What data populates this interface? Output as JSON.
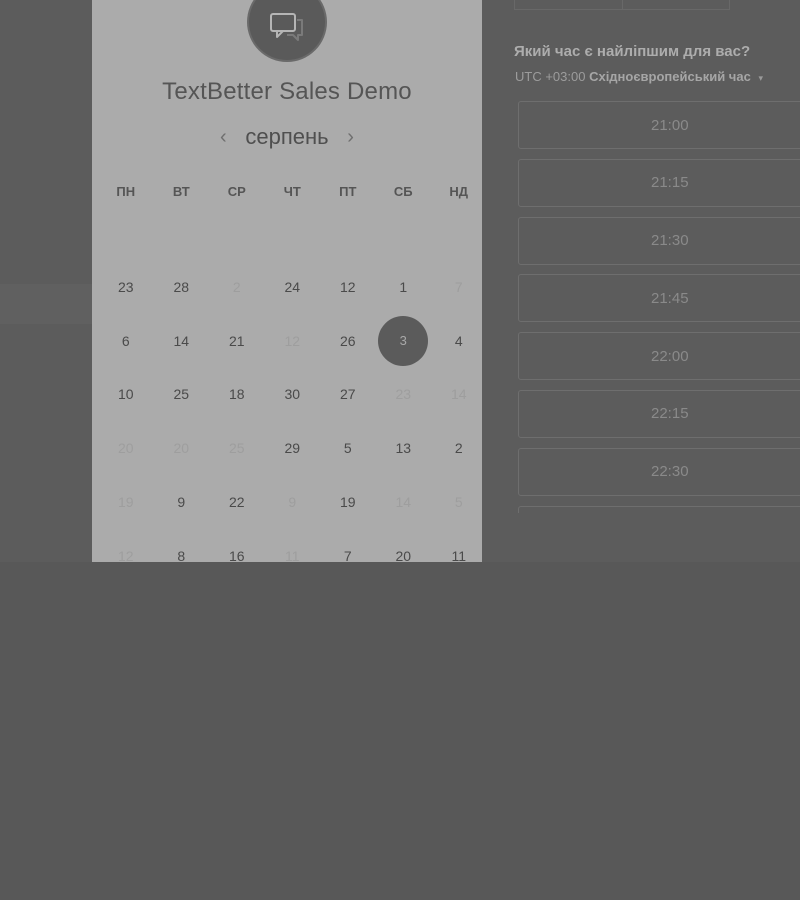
{
  "event": {
    "title": "TextBetter Sales Demo",
    "icon": "chat-bubble-icon"
  },
  "calendar": {
    "month": "серпень",
    "prev_icon": "‹",
    "next_icon": "›",
    "weekdays": [
      "ПН",
      "ВТ",
      "СР",
      "ЧТ",
      "ПТ",
      "СБ",
      "НД"
    ],
    "days": [
      {
        "label": "23",
        "muted": false
      },
      {
        "label": "28",
        "muted": false
      },
      {
        "label": "2",
        "muted": true
      },
      {
        "label": "24",
        "muted": false
      },
      {
        "label": "12",
        "muted": false
      },
      {
        "label": "1",
        "muted": false
      },
      {
        "label": "7",
        "muted": true
      },
      {
        "label": "6",
        "muted": false
      },
      {
        "label": "14",
        "muted": false
      },
      {
        "label": "21",
        "muted": false
      },
      {
        "label": "12",
        "muted": true
      },
      {
        "label": "26",
        "muted": false
      },
      {
        "label": "3",
        "muted": false,
        "selected": true
      },
      {
        "label": "4",
        "muted": false
      },
      {
        "label": "10",
        "muted": false
      },
      {
        "label": "25",
        "muted": false
      },
      {
        "label": "18",
        "muted": false
      },
      {
        "label": "30",
        "muted": false
      },
      {
        "label": "27",
        "muted": false
      },
      {
        "label": "23",
        "muted": true
      },
      {
        "label": "14",
        "muted": true
      },
      {
        "label": "20",
        "muted": true
      },
      {
        "label": "20",
        "muted": true
      },
      {
        "label": "25",
        "muted": true
      },
      {
        "label": "29",
        "muted": false
      },
      {
        "label": "5",
        "muted": false
      },
      {
        "label": "13",
        "muted": false
      },
      {
        "label": "2",
        "muted": false
      },
      {
        "label": "19",
        "muted": true
      },
      {
        "label": "9",
        "muted": false
      },
      {
        "label": "22",
        "muted": false
      },
      {
        "label": "9",
        "muted": true
      },
      {
        "label": "19",
        "muted": false
      },
      {
        "label": "14",
        "muted": true
      },
      {
        "label": "5",
        "muted": true
      },
      {
        "label": "12",
        "muted": true
      },
      {
        "label": "8",
        "muted": false
      },
      {
        "label": "16",
        "muted": false
      },
      {
        "label": "11",
        "muted": true
      },
      {
        "label": "7",
        "muted": false
      },
      {
        "label": "20",
        "muted": false
      },
      {
        "label": "11",
        "muted": false
      }
    ]
  },
  "times": {
    "question": "Який час є найліпшим для вас?",
    "tz_offset": "UTC +03:00",
    "tz_name": "Східноєвропейський час",
    "tz_caret": "▾",
    "slots": [
      "21:00",
      "21:15",
      "21:30",
      "21:45",
      "22:00",
      "22:15",
      "22:30"
    ]
  },
  "colors": {
    "overlay": "#585858",
    "panel": "#ababab",
    "selected_day": "#5b5b5b"
  }
}
